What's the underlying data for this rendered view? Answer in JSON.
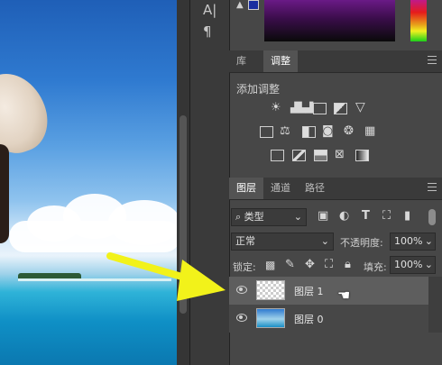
{
  "tools": {
    "type_tool_glyph": "A|",
    "paragraph_glyph": "¶"
  },
  "color_panel": {
    "fg_swatch_color": "#1a2fa0",
    "alert_glyph": "▲"
  },
  "adjust_panel": {
    "tabs": [
      {
        "label": "库"
      },
      {
        "label": "调整"
      }
    ],
    "title": "添加调整"
  },
  "layers_panel": {
    "tabs": [
      {
        "label": "图层"
      },
      {
        "label": "通道"
      },
      {
        "label": "路径"
      }
    ],
    "filter_kind": "类型",
    "blend_mode": "正常",
    "opacity_label": "不透明度:",
    "opacity_value": "100%",
    "lock_label": "锁定:",
    "fill_label": "填充:",
    "fill_value": "100%",
    "layers": [
      {
        "name": "图层 1"
      },
      {
        "name": "图层 0"
      }
    ]
  },
  "colors": {
    "arrow": "#f2f21a",
    "selected_row": "#5e5e5e"
  }
}
